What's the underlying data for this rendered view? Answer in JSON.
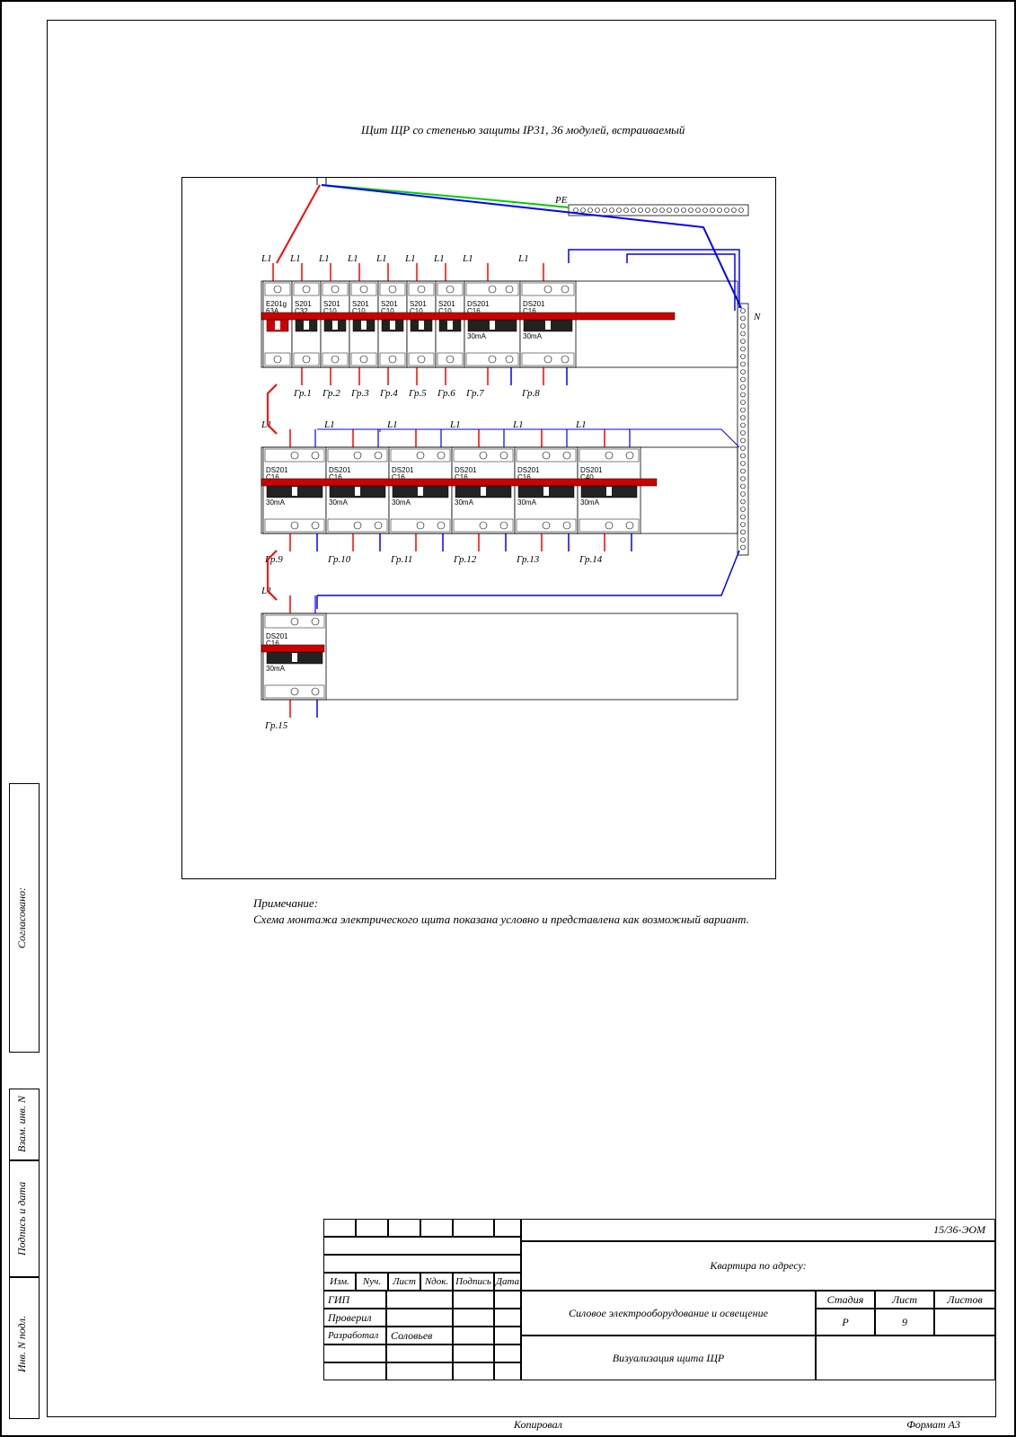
{
  "title": "Щит ЩР со степенью защиты IP31, 36 модулей, встраиваемый",
  "pe": "PE",
  "n": "N",
  "row1": {
    "phases": [
      "L1",
      "L1",
      "L1",
      "L1",
      "L1",
      "L1",
      "L1",
      "L1",
      "L1"
    ],
    "breakers": [
      {
        "l1": "E201g",
        "l2": "63A",
        "switch": true
      },
      {
        "l1": "S201",
        "l2": "C32"
      },
      {
        "l1": "S201",
        "l2": "C10"
      },
      {
        "l1": "S201",
        "l2": "C10"
      },
      {
        "l1": "S201",
        "l2": "C10"
      },
      {
        "l1": "S201",
        "l2": "C10"
      },
      {
        "l1": "S201",
        "l2": "C10"
      },
      {
        "l1": "DS201",
        "l2": "C16",
        "l3": "30mA",
        "wide": true
      },
      {
        "l1": "DS201",
        "l2": "C16",
        "l3": "30mA",
        "wide": true
      }
    ],
    "groups": [
      "Гр.1",
      "Гр.2",
      "Гр.3",
      "Гр.4",
      "Гр.5",
      "Гр.6",
      "Гр.7",
      "Гр.8"
    ]
  },
  "row2": {
    "phases": [
      "L1",
      "L1",
      "L1",
      "L1",
      "L1",
      "L1"
    ],
    "breakers": [
      {
        "l1": "DS201",
        "l2": "C16",
        "l3": "30mA",
        "wide": true
      },
      {
        "l1": "DS201",
        "l2": "C16",
        "l3": "30mA",
        "wide": true
      },
      {
        "l1": "DS201",
        "l2": "C16",
        "l3": "30mA",
        "wide": true
      },
      {
        "l1": "DS201",
        "l2": "C16",
        "l3": "30mA",
        "wide": true
      },
      {
        "l1": "DS201",
        "l2": "C16",
        "l3": "30mA",
        "wide": true
      },
      {
        "l1": "DS201",
        "l2": "C40",
        "l3": "30mA",
        "wide": true
      }
    ],
    "groups": [
      "Гр.9",
      "Гр.10",
      "Гр.11",
      "Гр.12",
      "Гр.13",
      "Гр.14"
    ]
  },
  "row3": {
    "phases": [
      "L1"
    ],
    "breakers": [
      {
        "l1": "DS201",
        "l2": "C16",
        "l3": "30mA",
        "wide": true
      }
    ],
    "groups": [
      "Гр.15"
    ]
  },
  "note_title": "Примечание:",
  "note_body": "Схема монтажа электрического щита показана условно и представлена как возможный вариант.",
  "side": {
    "agreed": "Согласовано:",
    "inv_podl": "Инв. N подл.",
    "sign_date": "Подпись и дата",
    "vzam": "Взам. инв. N"
  },
  "tb": {
    "doc": "15/36-ЭОМ",
    "addr": "Квартира по адресу:",
    "main": "Силовое электрооборудование и освещение",
    "viz": "Визуализация щита ЩР",
    "stage_h": "Стадия",
    "sheet_h": "Лист",
    "sheets_h": "Листов",
    "stage": "Р",
    "sheet": "9",
    "izm": "Изм.",
    "nuch": "Nуч.",
    "list": "Лист",
    "ndok": "Nдок.",
    "sign": "Подпись",
    "date": "Дата",
    "gip": "ГИП",
    "check": "Проверил",
    "dev": "Разработал",
    "dev_name": "Соловьев",
    "copy": "Копировал",
    "fmt": "Формат А3"
  }
}
